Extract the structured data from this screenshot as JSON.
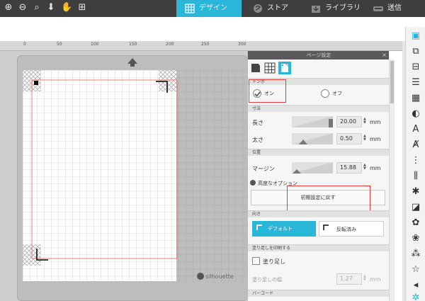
{
  "topbar": {
    "tools": [
      {
        "icon": "zoom-in-icon",
        "glyph": "⊕"
      },
      {
        "icon": "zoom-out-icon",
        "glyph": "⊖"
      },
      {
        "icon": "zoom-select-icon",
        "glyph": "⌕"
      },
      {
        "icon": "move-down-icon",
        "glyph": "⬇"
      },
      {
        "icon": "pan-hand-icon",
        "glyph": "✋"
      },
      {
        "icon": "fit-to-page-icon",
        "glyph": "⊞"
      }
    ],
    "tabs": {
      "design": "デザイン",
      "store": "ストア",
      "library": "ライブラリ",
      "send": "送信"
    },
    "active_tab_color": "#29b6d8"
  },
  "ruler": {
    "labels": [
      "0",
      "50",
      "100",
      "150",
      "200",
      "250",
      "300"
    ]
  },
  "canvas": {
    "brand": "silhouette"
  },
  "panel": {
    "title": "ページ設定",
    "close": "×",
    "registration": {
      "section": "トンボ",
      "on_label": "オン",
      "off_label": "オフ",
      "selected": "on"
    },
    "dimensions": {
      "section": "寸法",
      "length_label": "長さ",
      "length_value": "20.00",
      "thickness_label": "太さ",
      "thickness_value": "0.50",
      "unit": "mm"
    },
    "position": {
      "section": "位置",
      "margin_label": "マージン",
      "margin_value": "15.88",
      "unit": "mm"
    },
    "advanced": {
      "label": "高度なオプション",
      "reset_button": "初期設定に戻す"
    },
    "orientation": {
      "section": "向き",
      "default_label": "デフォルト",
      "reversed_label": "反転済み"
    },
    "bleed": {
      "section": "塗り足しを印刷する",
      "checkbox_label": "塗り足し",
      "width_label": "塗り足しの幅",
      "width_value": "1.27",
      "unit": "mm"
    },
    "barcode": {
      "section": "バーコード"
    }
  },
  "colors": {
    "accent": "#29b6d8",
    "highlight": "#e23b3b",
    "cut_line": "#e65a5a"
  }
}
